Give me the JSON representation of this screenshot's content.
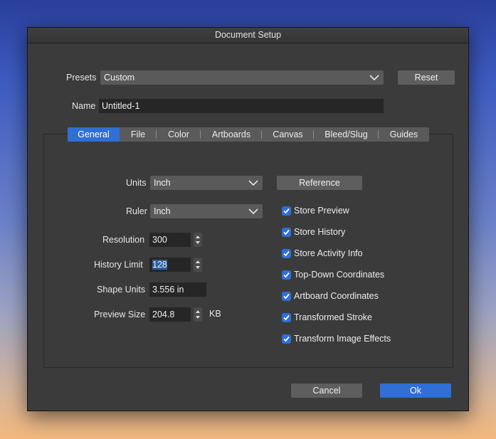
{
  "window": {
    "title": "Document Setup"
  },
  "presets": {
    "label": "Presets",
    "value": "Custom",
    "reset_label": "Reset"
  },
  "name": {
    "label": "Name",
    "value": "Untitled-1"
  },
  "tabs": [
    {
      "label": "General",
      "active": true
    },
    {
      "label": "File"
    },
    {
      "label": "Color"
    },
    {
      "label": "Artboards"
    },
    {
      "label": "Canvas"
    },
    {
      "label": "Bleed/Slug"
    },
    {
      "label": "Guides"
    }
  ],
  "general": {
    "units": {
      "label": "Units",
      "value": "Inch"
    },
    "reference_label": "Reference",
    "ruler": {
      "label": "Ruler",
      "value": "Inch"
    },
    "resolution": {
      "label": "Resolution",
      "value": "300"
    },
    "history_limit": {
      "label": "History Limit",
      "value": "128"
    },
    "shape_units": {
      "label": "Shape Units",
      "value": "3.556 in"
    },
    "preview_size": {
      "label": "Preview Size",
      "value": "204.8",
      "unit": "KB"
    },
    "checkboxes": [
      {
        "label": "Store Preview",
        "checked": true
      },
      {
        "label": "Store History",
        "checked": true
      },
      {
        "label": "Store Activity Info",
        "checked": true
      },
      {
        "label": "Top-Down Coordinates",
        "checked": true
      },
      {
        "label": "Artboard Coordinates",
        "checked": true
      },
      {
        "label": "Transformed Stroke",
        "checked": true
      },
      {
        "label": "Transform Image Effects",
        "checked": true
      }
    ]
  },
  "footer": {
    "cancel_label": "Cancel",
    "ok_label": "Ok"
  },
  "colors": {
    "accent": "#2f6fd6",
    "window_bg": "#3b3b3b",
    "control_bg": "#5a5a5a",
    "field_bg": "#262626"
  }
}
